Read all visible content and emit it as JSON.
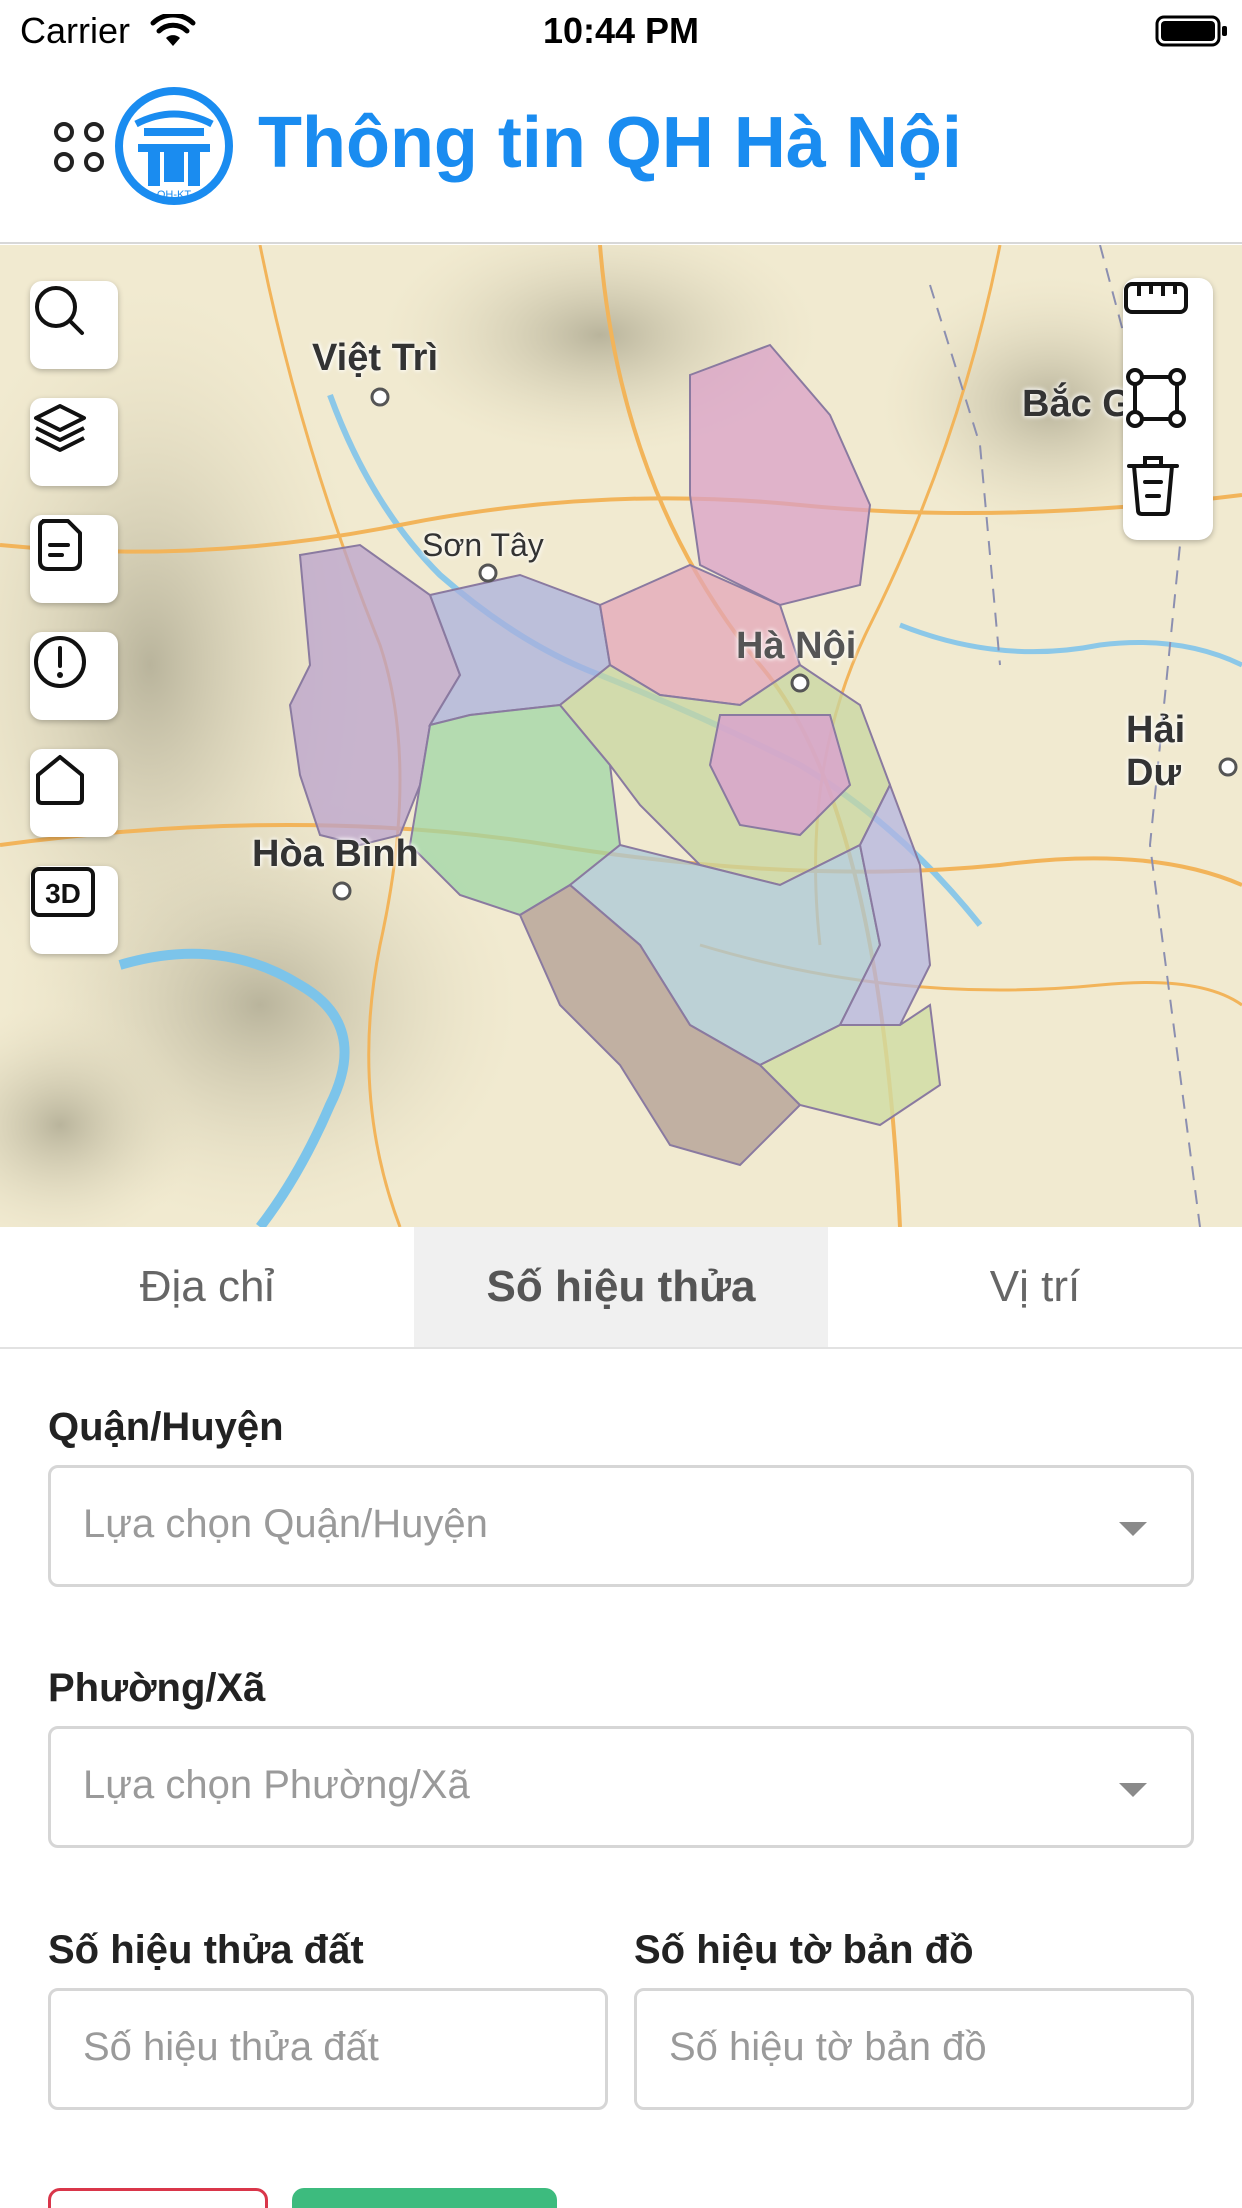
{
  "status_bar": {
    "carrier": "Carrier",
    "time": "10:44 PM"
  },
  "header": {
    "title": "Thông tin QH Hà Nội",
    "logo_text": "QH-KT"
  },
  "map": {
    "labels": {
      "viet_tri": "Việt Trì",
      "son_tay": "Sơn Tây",
      "ha_noi": "Hà Nội",
      "hoa_binh": "Hòa Bình",
      "bac_giang": "Bắc Giang",
      "hai_duong": "Hải Dư"
    },
    "left_tools": [
      "search-icon",
      "layers-icon",
      "document-icon",
      "alert-icon",
      "home-icon",
      "3d-icon"
    ],
    "three_d_label": "3D",
    "right_tools": [
      "ruler-icon",
      "draw-polygon-icon",
      "trash-icon"
    ]
  },
  "tabs": [
    {
      "label": "Địa chỉ",
      "active": false
    },
    {
      "label": "Số hiệu thửa",
      "active": true
    },
    {
      "label": "Vị trí",
      "active": false
    }
  ],
  "form": {
    "district": {
      "label": "Quận/Huyện",
      "placeholder": "Lựa chọn Quận/Huyện"
    },
    "ward": {
      "label": "Phường/Xã",
      "placeholder": "Lựa chọn Phường/Xã"
    },
    "parcel_number": {
      "label": "Số hiệu thửa đất",
      "placeholder": "Số hiệu thửa đất"
    },
    "map_sheet_number": {
      "label": "Số hiệu tờ bản đồ",
      "placeholder": "Số hiệu tờ bản đồ"
    }
  },
  "colors": {
    "accent": "#1a8cf0",
    "danger": "#d9364a",
    "success": "#3dbb7e"
  }
}
